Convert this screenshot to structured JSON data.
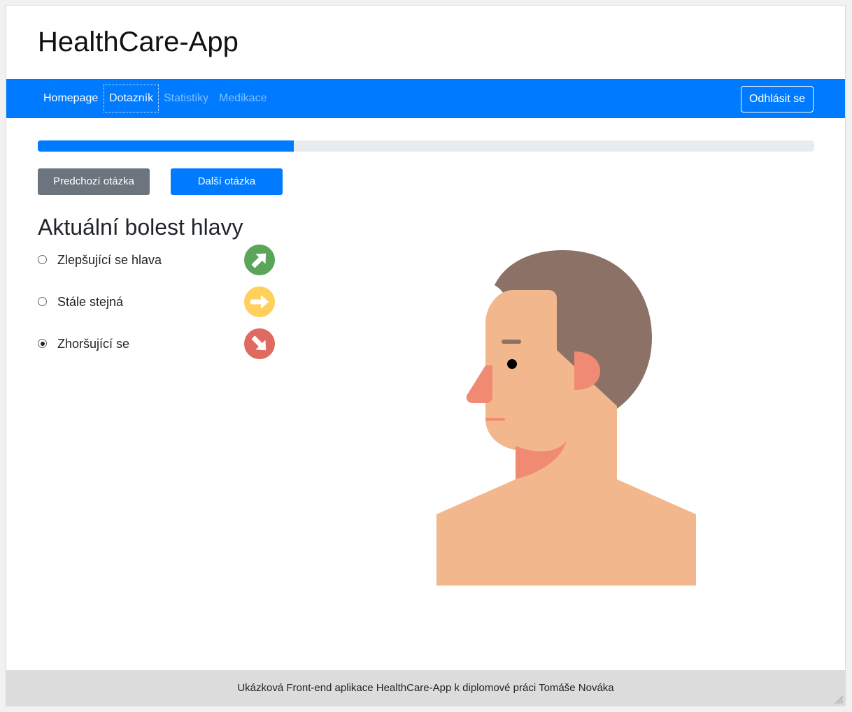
{
  "app": {
    "title": "HealthCare-App"
  },
  "nav": {
    "items": [
      {
        "label": "Homepage",
        "state": "active"
      },
      {
        "label": "Dotazník",
        "state": "focused"
      },
      {
        "label": "Statistiky",
        "state": "inactive"
      },
      {
        "label": "Medikace",
        "state": "inactive"
      }
    ],
    "logout_label": "Odhlásit se"
  },
  "progress": {
    "value_percent": 33
  },
  "buttons": {
    "prev_label": "Predchozí otázka",
    "next_label": "Další otázka"
  },
  "question": {
    "title": "Aktuální bolest hlavy",
    "options": [
      {
        "label": "Zlepšující se hlava",
        "checked": false,
        "icon": "arrow-up-right-icon",
        "icon_color": "#5aa55a"
      },
      {
        "label": "Stále stejná",
        "checked": false,
        "icon": "arrow-right-icon",
        "icon_color": "#ffd15c"
      },
      {
        "label": "Zhoršující se",
        "checked": true,
        "icon": "arrow-down-right-icon",
        "icon_color": "#e06a5f"
      }
    ]
  },
  "illustration": {
    "name": "head-profile-illustration",
    "colors": {
      "skin": "#f2b78c",
      "hair": "#8c7266",
      "accent": "#f08a72"
    }
  },
  "footer": {
    "text": "Ukázková Front-end aplikace HealthCare-App k diplomové práci Tomáše Nováka"
  },
  "theme": {
    "primary": "#007bff",
    "secondary": "#6c757d",
    "footer_bg": "#dcdcdc"
  }
}
